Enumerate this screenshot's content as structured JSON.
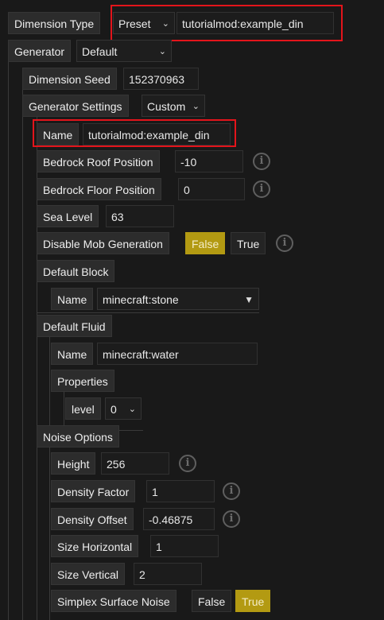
{
  "dimension_type": {
    "label": "Dimension Type",
    "selected": "Preset",
    "value": "tutorialmod:example_din"
  },
  "generator": {
    "label": "Generator",
    "selected": "Default"
  },
  "dimension_seed": {
    "label": "Dimension Seed",
    "value": "152370963"
  },
  "generator_settings": {
    "label": "Generator Settings",
    "selected": "Custom"
  },
  "name": {
    "label": "Name",
    "value": "tutorialmod:example_din"
  },
  "bedrock_roof": {
    "label": "Bedrock Roof Position",
    "value": "-10",
    "icon": "info-icon"
  },
  "bedrock_floor": {
    "label": "Bedrock Floor Position",
    "value": "0",
    "icon": "info-icon"
  },
  "sea_level": {
    "label": "Sea Level",
    "value": "63"
  },
  "disable_mob_generation": {
    "label": "Disable Mob Generation",
    "false_label": "False",
    "true_label": "True",
    "selected": "False",
    "icon": "info-icon"
  },
  "default_block": {
    "label": "Default Block",
    "name_label": "Name",
    "name_value": "minecraft:stone",
    "dropdown_icon": "caret-down-icon"
  },
  "default_fluid": {
    "label": "Default Fluid",
    "name_label": "Name",
    "name_value": "minecraft:water",
    "properties_label": "Properties",
    "level_label": "level",
    "level_value": "0"
  },
  "noise_options": {
    "label": "Noise Options",
    "height": {
      "label": "Height",
      "value": "256"
    },
    "density_factor": {
      "label": "Density Factor",
      "value": "1"
    },
    "density_offset": {
      "label": "Density Offset",
      "value": "-0.46875"
    },
    "size_horizontal": {
      "label": "Size Horizontal",
      "value": "1"
    },
    "size_vertical": {
      "label": "Size Vertical",
      "value": "2"
    },
    "simplex_surface_noise": {
      "label": "Simplex Surface Noise",
      "false_label": "False",
      "true_label": "True",
      "selected": "True"
    }
  },
  "colors": {
    "toggle_active": "#b39a12",
    "highlight_box": "#e3141b",
    "background": "#191919"
  }
}
